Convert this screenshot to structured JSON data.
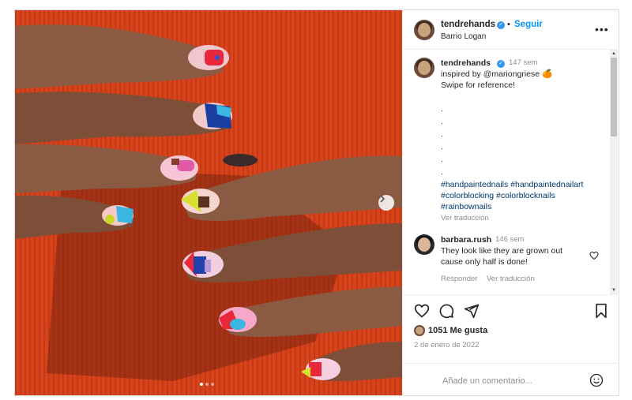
{
  "post": {
    "author": "tendrehands",
    "follow_label": "Seguir",
    "separator": "•",
    "location": "Barrio Logan",
    "verified_mark": "✓",
    "more_label": "•••",
    "carousel": {
      "slides": 3,
      "active": 0
    }
  },
  "caption": {
    "author": "tendrehands",
    "time": "147 sem",
    "line1": "inspired by @mariongriese 🍊",
    "line2": "Swipe for reference!",
    "dots": [
      ".",
      ".",
      ".",
      ".",
      ".",
      "."
    ],
    "hashtags": "#handpaintednails #handpaintednailart #colorblocking #colorblocknails #rainbownails",
    "see_translation": "Ver traducción"
  },
  "comment": {
    "author": "barbara.rush",
    "time": "146 sem",
    "text": "They look like they are grown out cause only half is done!",
    "reply": "Responder",
    "see_translation": "Ver traducción"
  },
  "actions": {
    "likes": "1051 Me gusta",
    "date": "2 de enero de 2022",
    "comment_placeholder": "Añade un comentario..."
  },
  "icons": {
    "like": "heart-icon",
    "comment": "comment-icon",
    "share": "share-icon",
    "save": "bookmark-icon",
    "emoji": "emoji-icon",
    "next": "chevron-right-icon"
  },
  "colors": {
    "link": "#0095f6",
    "hashtag": "#00376b",
    "muted": "#8e8e8e",
    "verified": "#3897f0"
  }
}
